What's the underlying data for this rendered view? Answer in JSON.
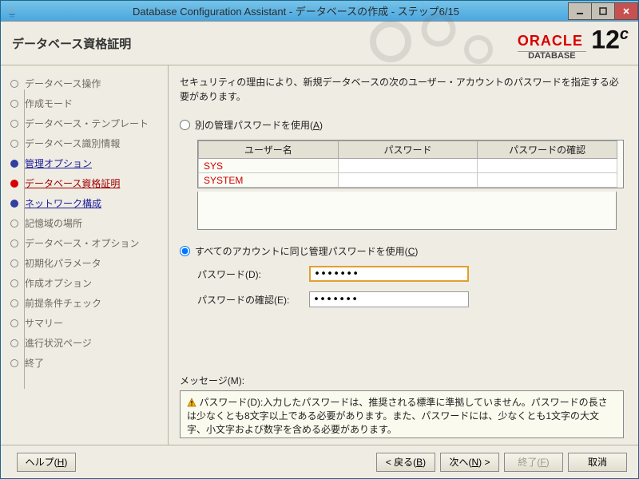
{
  "window": {
    "title": "Database Configuration Assistant - データベースの作成 - ステップ6/15"
  },
  "header": {
    "title": "データベース資格証明"
  },
  "logo": {
    "brand": "ORACLE",
    "sub": "DATABASE",
    "ver_num": "12",
    "ver_c": "c"
  },
  "sidebar": {
    "items": [
      {
        "label": "データベース操作"
      },
      {
        "label": "作成モード"
      },
      {
        "label": "データベース・テンプレート"
      },
      {
        "label": "データベース識別情報"
      },
      {
        "label": "管理オプション"
      },
      {
        "label": "データベース資格証明"
      },
      {
        "label": "ネットワーク構成"
      },
      {
        "label": "記憶域の場所"
      },
      {
        "label": "データベース・オプション"
      },
      {
        "label": "初期化パラメータ"
      },
      {
        "label": "作成オプション"
      },
      {
        "label": "前提条件チェック"
      },
      {
        "label": "サマリー"
      },
      {
        "label": "進行状況ページ"
      },
      {
        "label": "終了"
      }
    ]
  },
  "content": {
    "intro": "セキュリティの理由により、新規データベースの次のユーザー・アカウントのパスワードを指定する必要があります。",
    "radio_different_pre": "別の管理パスワードを使用(",
    "radio_different_key": "A",
    "radio_different_post": ")",
    "table": {
      "col_user": "ユーザー名",
      "col_pwd": "パスワード",
      "col_confirm": "パスワードの確認",
      "rows": [
        {
          "user": "SYS"
        },
        {
          "user": "SYSTEM"
        }
      ]
    },
    "radio_same_pre": "すべてのアカウントに同じ管理パスワードを使用(",
    "radio_same_key": "C",
    "radio_same_post": ")",
    "pwd_label_pre": "パスワード(",
    "pwd_label_key": "D",
    "pwd_label_post": "):",
    "pwd_value": "•••••••",
    "confirm_label_pre": "パスワードの確認(",
    "confirm_label_key": "E",
    "confirm_label_post": "):",
    "confirm_value": "•••••••",
    "msg_label_pre": "メッセージ(",
    "msg_label_key": "M",
    "msg_label_post": "):",
    "msg_text": "パスワード(D):入力したパスワードは、推奨される標準に準拠していません。パスワードの長さは少なくとも8文字以上である必要があります。また、パスワードには、少なくとも1文字の大文字、小文字および数字を含める必要があります。"
  },
  "footer": {
    "help_pre": "ヘルプ(",
    "help_key": "H",
    "help_post": ")",
    "back_pre": "< 戻る(",
    "back_key": "B",
    "back_post": ")",
    "next_pre": "次へ(",
    "next_key": "N",
    "next_post": ") >",
    "finish_pre": "終了(",
    "finish_key": "F",
    "finish_post": ")",
    "cancel": "取消"
  }
}
